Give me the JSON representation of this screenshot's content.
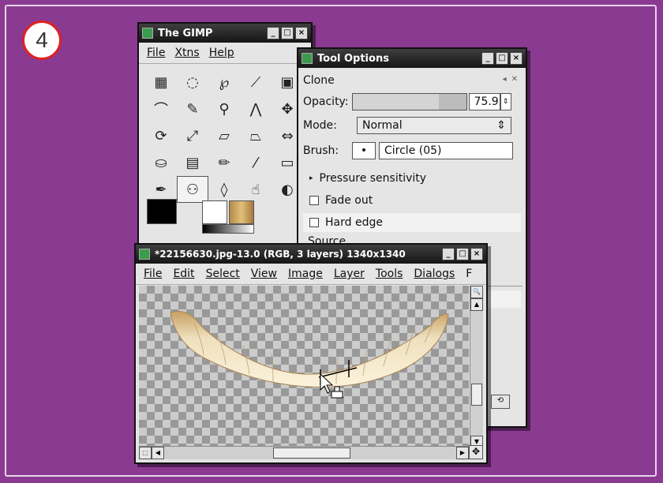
{
  "step_number": "4",
  "toolbox": {
    "title": "The GIMP",
    "menu": [
      "File",
      "Xtns",
      "Help"
    ],
    "tool_icons": [
      "rect-select-icon",
      "ellipse-select-icon",
      "lasso-icon",
      "fuzzy-select-icon",
      "color-select-icon",
      "paths-icon",
      "color-picker-icon",
      "zoom-icon",
      "measure-icon",
      "move-icon",
      "rotate-icon",
      "scale-icon",
      "shear-icon",
      "perspective-icon",
      "flip-icon",
      "bucket-fill-icon",
      "blend-icon",
      "pencil-icon",
      "paintbrush-icon",
      "eraser-icon",
      "airbrush-icon",
      "clone-stamp-icon",
      "blur-icon",
      "smudge-icon",
      "dodge-burn-icon"
    ],
    "selected_tool": "clone-stamp-icon"
  },
  "tool_options": {
    "title": "Tool Options",
    "tool_name": "Clone",
    "opacity_label": "Opacity:",
    "opacity_value": "75.9",
    "opacity_fraction": 0.759,
    "mode_label": "Mode:",
    "mode_value": "Normal",
    "brush_label": "Brush:",
    "brush_value": "Circle (05)",
    "pressure_label": "Pressure sensitivity",
    "fade_label": "Fade out",
    "hard_edge_label": "Hard edge",
    "source_label": "Source"
  },
  "image_window": {
    "title": "*22156630.jpg-13.0 (RGB, 3 layers) 1340x1340",
    "menu": [
      "File",
      "Edit",
      "Select",
      "View",
      "Image",
      "Layer",
      "Tools",
      "Dialogs",
      "F"
    ]
  },
  "colors": {
    "background": "#8b3a92",
    "step_ring": "#dd2222",
    "titlebar": "#1a1a1a",
    "window_bg": "#e5e5e5"
  }
}
